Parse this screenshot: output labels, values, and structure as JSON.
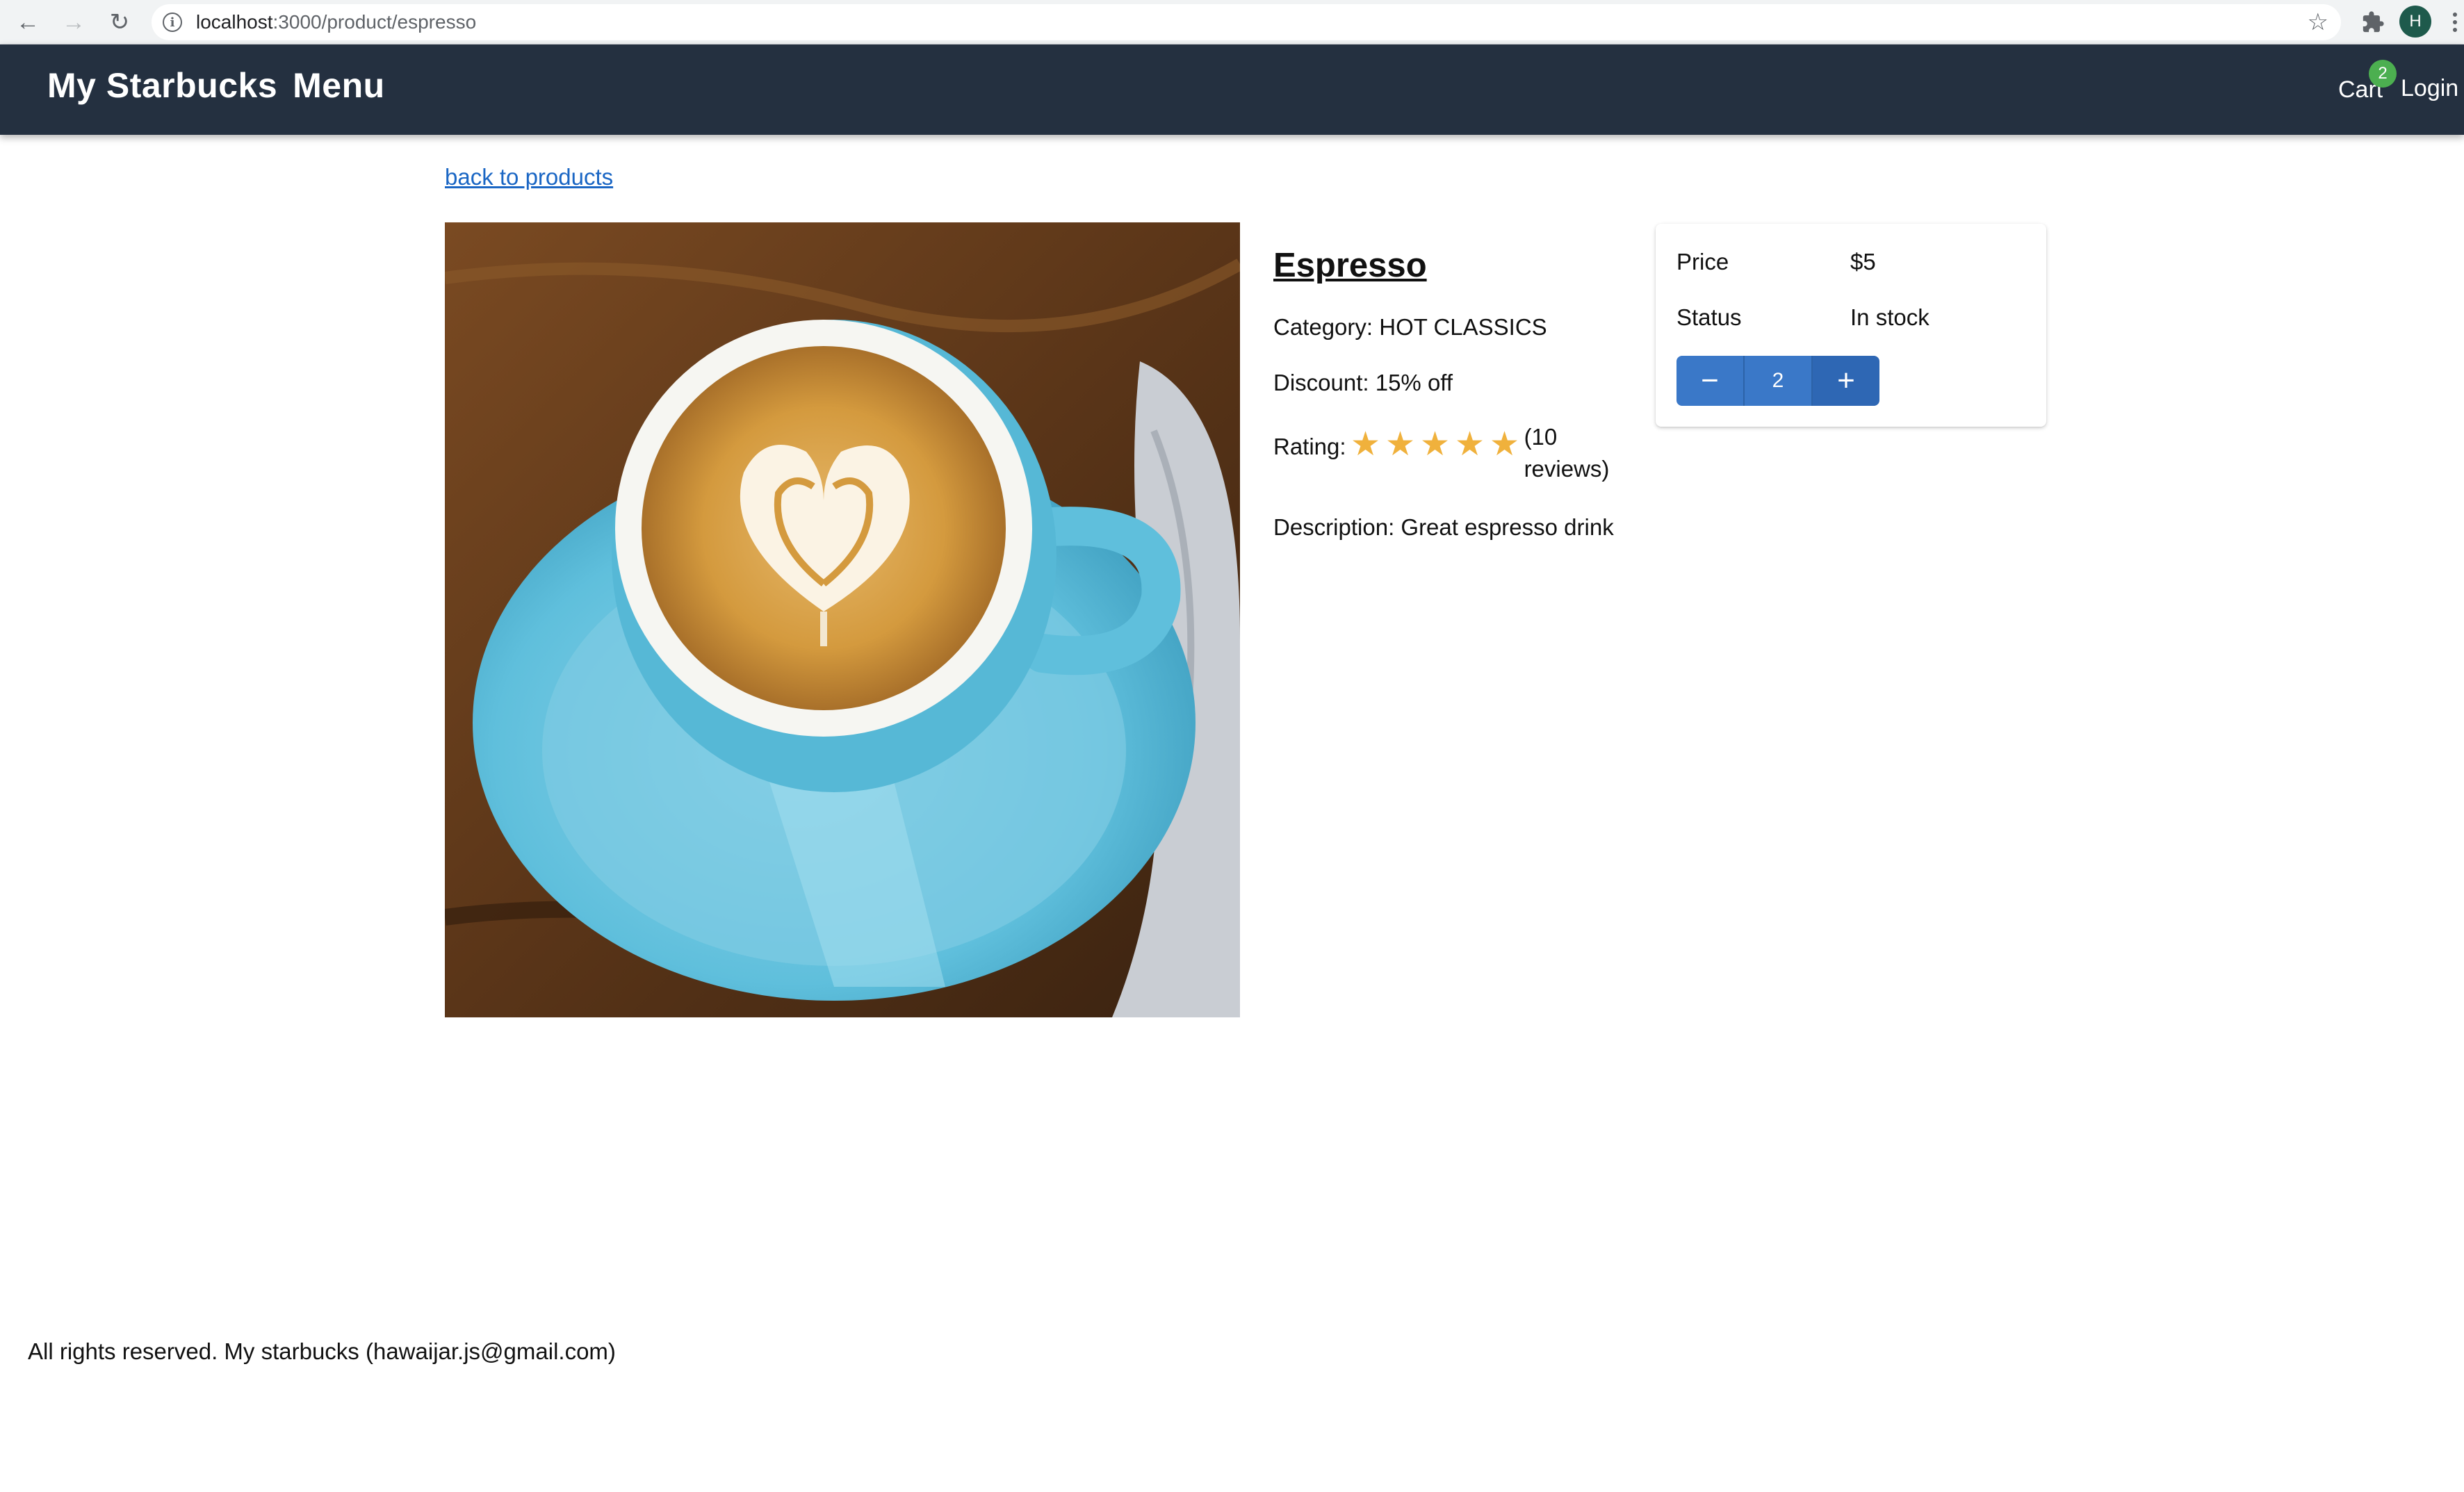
{
  "browser": {
    "url_host": "localhost",
    "url_path": ":3000/product/espresso"
  },
  "header": {
    "brand_part1": "My Starbucks",
    "brand_part2": "Menu",
    "cart_label": "Cart",
    "cart_count": "2",
    "login_label": "Login"
  },
  "main": {
    "back_link": "back to products",
    "product_name": "Espresso",
    "category_label": "Category: HOT CLASSICS",
    "discount_label": "Discount: 15% off",
    "rating_label": "Rating:",
    "rating_value": 5,
    "rating_max": 5,
    "reviews_text": "(10 reviews)",
    "description": "Description: Great espresso drink"
  },
  "buy_card": {
    "price_label": "Price",
    "price_value": "$5",
    "status_label": "Status",
    "status_value": "In stock",
    "quantity": "2",
    "decrement_symbol": "−",
    "increment_symbol": "+"
  },
  "footer": {
    "text": "All rights reserved. My starbucks (hawaijar.js@gmail.com)"
  },
  "colors": {
    "header_bg": "#243040",
    "link": "#1a66c4",
    "star": "#f0b13c",
    "button": "#3a78c8",
    "badge": "#4caf50"
  }
}
